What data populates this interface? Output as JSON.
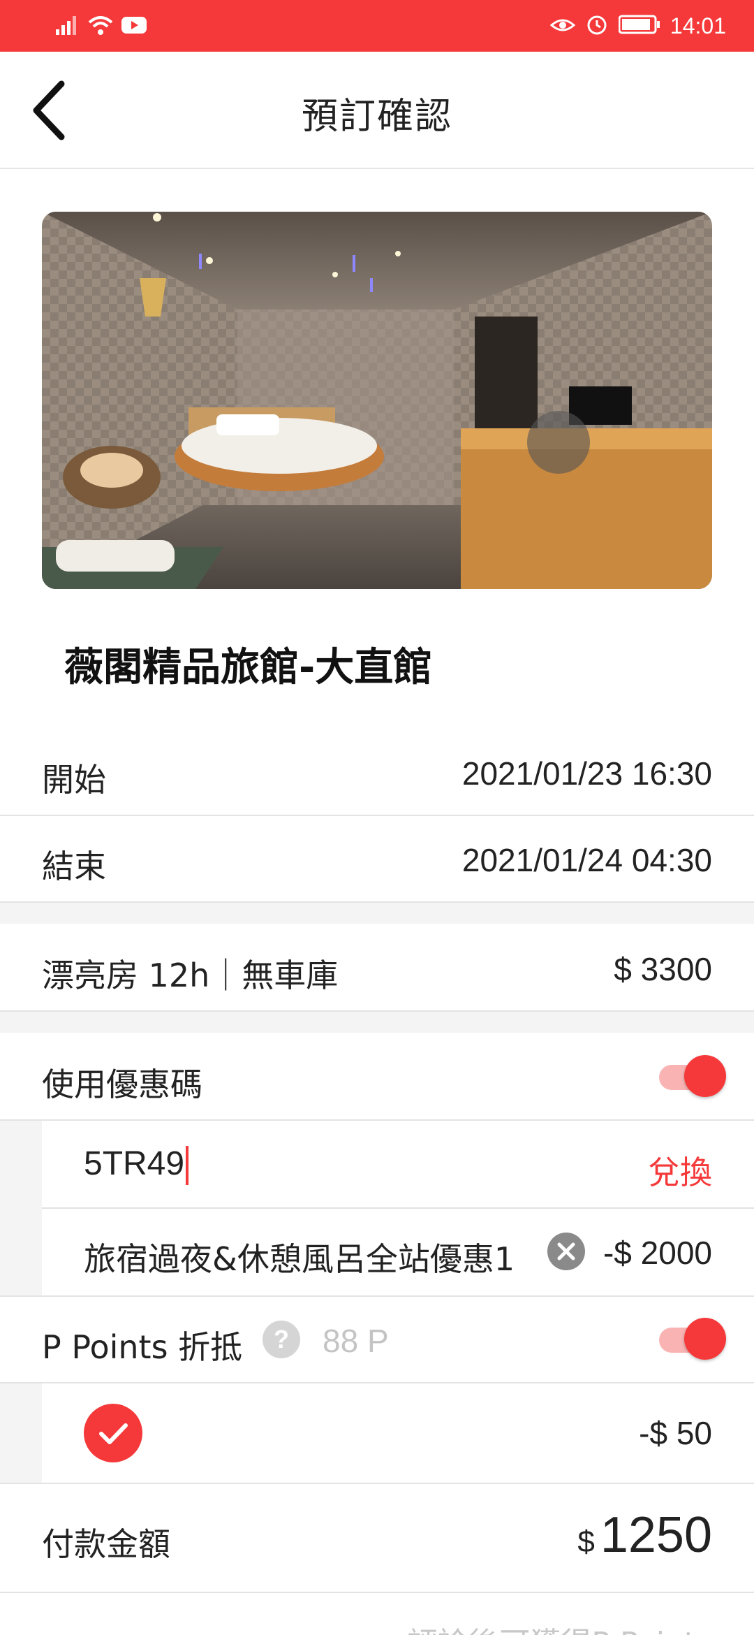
{
  "status_bar": {
    "time": "14:01",
    "icons": [
      "signal-icon",
      "wifi-icon",
      "youtube-icon",
      "eye-icon",
      "alarm-icon",
      "battery-icon"
    ]
  },
  "header": {
    "title": "預訂確認",
    "back_icon": "chevron-left-icon"
  },
  "hotel": {
    "name": "薇閣精品旅館-大直館"
  },
  "booking": {
    "start_label": "開始",
    "start_value": "2021/01/23 16:30",
    "end_label": "結束",
    "end_value": "2021/01/24 04:30",
    "room_label": "漂亮房 12h｜無車庫",
    "room_price": "$ 3300"
  },
  "coupon": {
    "toggle_label": "使用優惠碼",
    "enabled": true,
    "code_value": "5TR49",
    "redeem_label": "兌換",
    "applied_name": "旅宿過夜&休憩風呂全站優惠1",
    "applied_discount": "-$ 2000"
  },
  "points": {
    "label": "P Points 折抵",
    "help_glyph": "?",
    "available": "88 P",
    "enabled": true,
    "selected": true,
    "discount": "-$ 50"
  },
  "payment": {
    "label": "付款金額",
    "currency": "$",
    "amount": "1250"
  },
  "footer": {
    "note": "評論後可獲得P Points"
  },
  "colors": {
    "accent": "#f5393a",
    "accent_light": "#f9b3b3",
    "divider": "#e3e3e3",
    "section_gap": "#f4f4f4",
    "muted_text": "#c4c4c4"
  }
}
